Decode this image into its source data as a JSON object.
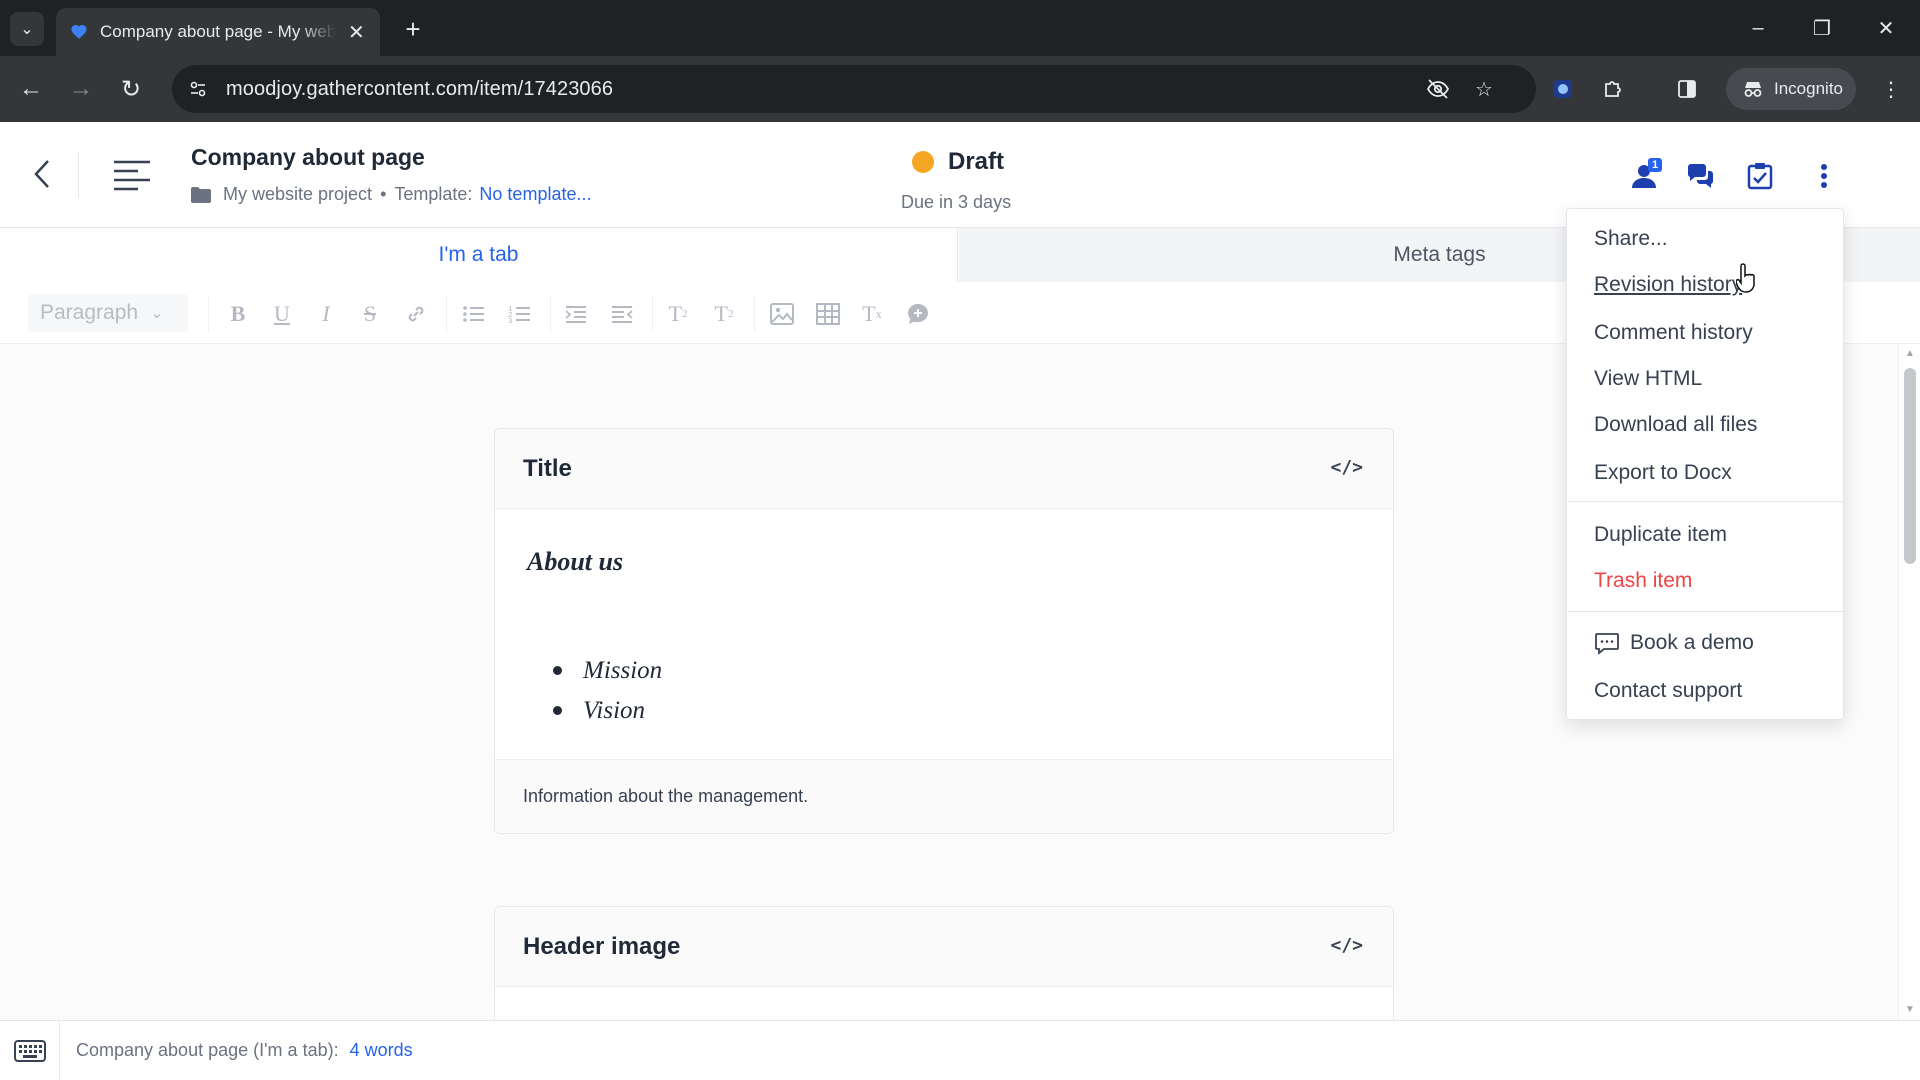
{
  "browser": {
    "tab_title": "Company about page - My website project",
    "url": "moodjoy.gathercontent.com/item/17423066",
    "incognito_label": "Incognito"
  },
  "header": {
    "item_title": "Company about page",
    "project": "My website project",
    "template_label": "Template:",
    "template_value": "No template...",
    "status": "Draft",
    "status_color": "#f5a623",
    "due": "Due in 3 days",
    "assignee_badge": "1"
  },
  "tabs": [
    {
      "label": "I'm a tab",
      "active": true
    },
    {
      "label": "Meta tags",
      "active": false
    }
  ],
  "editor_toolbar": {
    "paragraph_select": "Paragraph"
  },
  "fields": [
    {
      "title": "Title",
      "heading": "About us",
      "bullets": [
        "Mission",
        "Vision"
      ],
      "footer": "Information about the management."
    },
    {
      "title": "Header image"
    }
  ],
  "menu": {
    "items": [
      "Share...",
      "Revision history",
      "Comment history",
      "View HTML",
      "Download all files",
      "Export to Docx",
      "Duplicate item",
      "Trash item",
      "Book a demo",
      "Contact support"
    ],
    "danger_color": "#ef4444"
  },
  "statusbar": {
    "context": "Company about page (I'm a tab):",
    "word_count": "4 words"
  },
  "colors": {
    "accent": "#2563eb"
  }
}
